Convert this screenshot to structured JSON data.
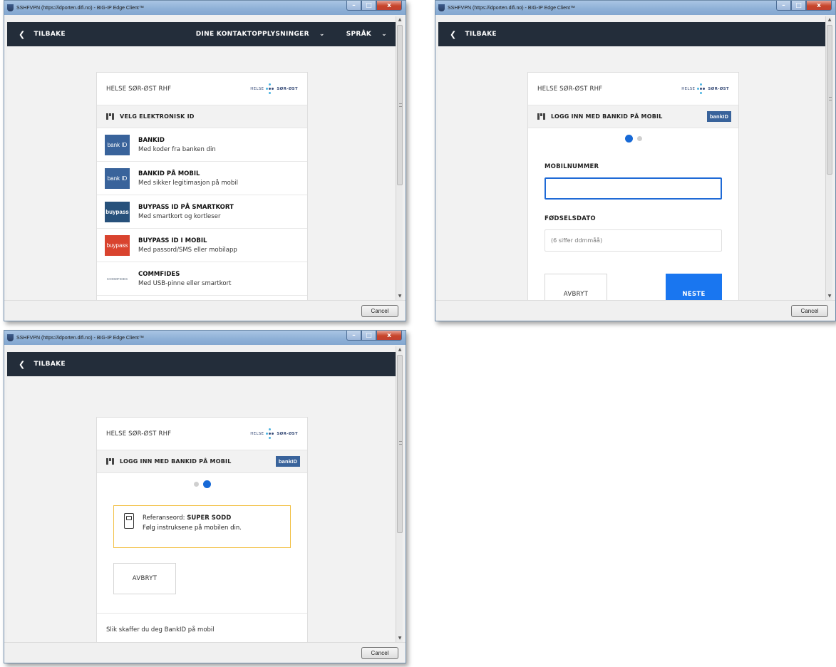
{
  "window": {
    "title": "SSHFVPN (https://idporten.difi.no) - BIG-IP Edge Client™",
    "close_glyph": "x",
    "cancel_label": "Cancel"
  },
  "nav": {
    "back_label": "TILBAKE",
    "contact_label": "DINE KONTAKTOPPLYSNINGER",
    "language_label": "SPRÅK"
  },
  "org": {
    "name": "HELSE SØR-ØST RHF",
    "logo_left": "HELSE",
    "logo_right": "SØR-ØST"
  },
  "select_screen": {
    "heading": "VELG ELEKTRONISK ID",
    "options": [
      {
        "title": "BANKID",
        "subtitle": "Med koder fra banken din",
        "logo_text": "bank ID",
        "logo_kind": "bank"
      },
      {
        "title": "BANKID PÅ MOBIL",
        "subtitle": "Med sikker legitimasjon på mobil",
        "logo_text": "bank ID",
        "logo_kind": "bank"
      },
      {
        "title": "BUYPASS ID PÅ SMARTKORT",
        "subtitle": "Med smartkort og kortleser",
        "logo_text": "buypass",
        "logo_kind": "bp1"
      },
      {
        "title": "BUYPASS ID I MOBIL",
        "subtitle": "Med passord/SMS eller mobilapp",
        "logo_text": "buypass",
        "logo_kind": "bp2"
      },
      {
        "title": "COMMFIDES",
        "subtitle": "Med USB-pinne eller smartkort",
        "logo_text": "COMMFIDES",
        "logo_kind": "cf"
      }
    ]
  },
  "mobile_login": {
    "heading": "LOGG INN MED BANKID PÅ MOBIL",
    "bankid_tag": "bankID",
    "mobile_label": "MOBILNUMMER",
    "mobile_value": "",
    "dob_label": "FØDSELSDATO",
    "dob_placeholder": "(6 siffer ddmmåå)",
    "cancel_label": "AVBRYT",
    "next_label": "NESTE",
    "current_step": 1,
    "total_steps": 2
  },
  "confirm_screen": {
    "heading": "LOGG INN MED BANKID PÅ MOBIL",
    "bankid_tag": "bankID",
    "reference_prefix": "Referanseord:",
    "reference_word": "SUPER SODD",
    "instruction": "Følg instruksene på mobilen din.",
    "cancel_label": "AVBRYT",
    "help_link": "Slik skaffer du deg BankID på mobil",
    "current_step": 2,
    "total_steps": 2
  },
  "colors": {
    "navbar": "#232d3a",
    "primary": "#1976f0",
    "bankid": "#39639b",
    "notice_border": "#f2c146"
  }
}
